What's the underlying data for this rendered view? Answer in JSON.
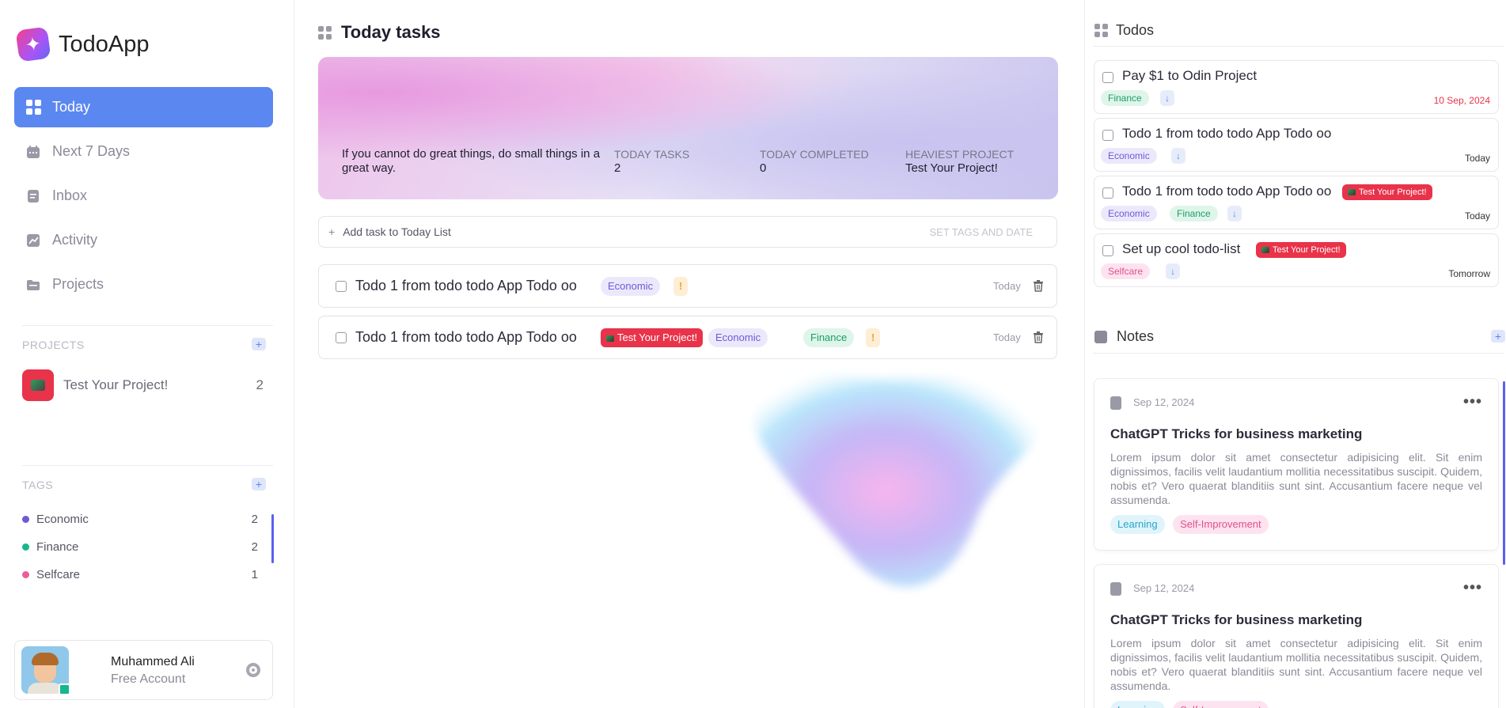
{
  "app": {
    "name": "TodoApp",
    "logo_icon": "sparkle-icon"
  },
  "nav": [
    {
      "label": "Today",
      "icon": "grid-icon",
      "active": true
    },
    {
      "label": "Next 7 Days",
      "icon": "calendar-icon",
      "active": false
    },
    {
      "label": "Inbox",
      "icon": "inbox-icon",
      "active": false
    },
    {
      "label": "Activity",
      "icon": "chart-icon",
      "active": false
    },
    {
      "label": "Projects",
      "icon": "folder-icon",
      "active": false
    }
  ],
  "projects": {
    "title": "PROJECTS",
    "add_label": "+",
    "items": [
      {
        "name": "Test Your Project!",
        "count": "2"
      }
    ]
  },
  "tags": {
    "title": "TAGS",
    "add_label": "+",
    "items": [
      {
        "name": "Economic",
        "count": "2",
        "color": "#6b5bd6"
      },
      {
        "name": "Finance",
        "count": "2",
        "color": "#14b88a"
      },
      {
        "name": "Selfcare",
        "count": "1",
        "color": "#ec5c9a"
      }
    ]
  },
  "user": {
    "name": "Muhammed Ali",
    "plan": "Free Account",
    "status_color": "#14b88a"
  },
  "main": {
    "title": "Today tasks",
    "hero": {
      "quote": "If you cannot do great things, do small things in a great way.",
      "stats": [
        {
          "label": "TODAY TASKS",
          "value": "2"
        },
        {
          "label": "TODAY COMPLETED",
          "value": "0"
        },
        {
          "label": "HEAVIEST PROJECT",
          "value": "Test Your Project!"
        }
      ]
    },
    "add_task": {
      "plus": "+",
      "placeholder": "Add task to Today List",
      "set_label": "SET TAGS AND DATE"
    },
    "tasks": [
      {
        "title": "Todo 1 from todo todo App Todo oo",
        "project": "",
        "tags": [
          "Economic"
        ],
        "priority": "!",
        "date": "Today"
      },
      {
        "title": "Todo 1 from todo todo App Todo oo",
        "project": "Test Your Project!",
        "tags": [
          "Economic",
          "Finance"
        ],
        "priority": "!",
        "date": "Today"
      }
    ]
  },
  "todos_panel": {
    "title": "Todos",
    "items": [
      {
        "title": "Pay $1 to Odin Project",
        "project": "",
        "tags": [
          "Finance"
        ],
        "priority": "↓",
        "date": "10 Sep, 2024"
      },
      {
        "title": "Todo 1 from todo todo App Todo oo",
        "project": "",
        "tags": [
          "Economic"
        ],
        "priority": "↓",
        "date": "Today"
      },
      {
        "title": "Todo 1 from todo todo App Todo oo",
        "project": "Test Your Project!",
        "tags": [
          "Economic",
          "Finance"
        ],
        "priority": "↓",
        "date": "Today"
      },
      {
        "title": "Set up cool todo-list",
        "project": "Test Your Project!",
        "tags": [
          "Selfcare"
        ],
        "priority": "↓",
        "date": "Tomorrow"
      }
    ]
  },
  "notes_panel": {
    "title": "Notes",
    "add_label": "+",
    "items": [
      {
        "date": "Sep 12, 2024",
        "more": "•••",
        "title": "ChatGPT Tricks for business marketing",
        "body": "Lorem ipsum dolor sit amet consectetur adipisicing elit. Sit enim dignissimos, facilis velit laudantium mollitia necessitatibus suscipit. Quidem, nobis et? Vero quaerat blanditiis sunt sint. Accusantium facere neque vel assumenda.",
        "tags": [
          "Learning",
          "Self-Improvement"
        ]
      },
      {
        "date": "Sep 12, 2024",
        "more": "•••",
        "title": "ChatGPT Tricks for business marketing",
        "body": "Lorem ipsum dolor sit amet consectetur adipisicing elit. Sit enim dignissimos, facilis velit laudantium mollitia necessitatibus suscipit. Quidem, nobis et? Vero quaerat blanditiis sunt sint. Accusantium facere neque vel assumenda.",
        "tags": [
          "Learning",
          "Self-Improvement"
        ]
      }
    ]
  },
  "colors": {
    "accent": "#5b87f0",
    "project_red": "#e8334a",
    "due_red": "#e8334a"
  }
}
